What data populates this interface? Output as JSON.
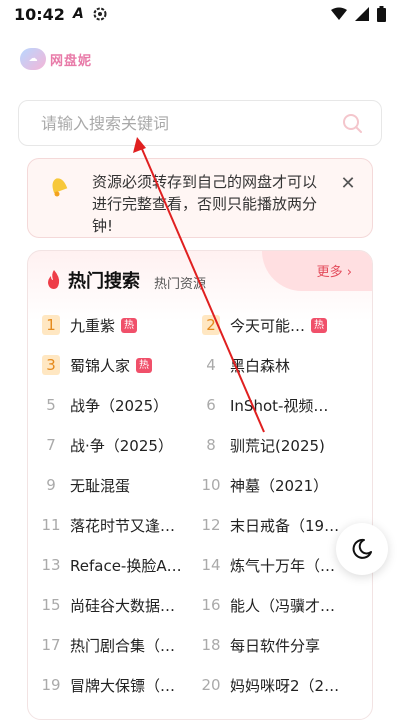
{
  "status_bar": {
    "time": "10:42"
  },
  "logo": {
    "text": "网盘妮"
  },
  "search": {
    "placeholder": "请输入搜索关键词",
    "value": ""
  },
  "notice": {
    "text": "资源必须转存到自己的网盘才可以进行完整查看，否则只能播放两分钟!"
  },
  "hot": {
    "title": "热门搜索",
    "subtitle": "热门资源",
    "more_label": "更多 ›",
    "hot_badge": "热",
    "items": [
      {
        "rank": "1",
        "title": "九重紫",
        "hot": true
      },
      {
        "rank": "2",
        "title": "今天可能…",
        "hot": true
      },
      {
        "rank": "3",
        "title": "蜀锦人家",
        "hot": true
      },
      {
        "rank": "4",
        "title": "黑白森林",
        "hot": false
      },
      {
        "rank": "5",
        "title": "战争（2025）",
        "hot": false
      },
      {
        "rank": "6",
        "title": "InShot-视频…",
        "hot": false
      },
      {
        "rank": "7",
        "title": "战·争（2025）",
        "hot": false
      },
      {
        "rank": "8",
        "title": "驯荒记(2025)",
        "hot": false
      },
      {
        "rank": "9",
        "title": "无耻混蛋",
        "hot": false
      },
      {
        "rank": "10",
        "title": "神墓（2021）",
        "hot": false
      },
      {
        "rank": "11",
        "title": "落花时节又逢…",
        "hot": false
      },
      {
        "rank": "12",
        "title": "末日戒备（19…",
        "hot": false
      },
      {
        "rank": "13",
        "title": "Reface-换脸A…",
        "hot": false
      },
      {
        "rank": "14",
        "title": "炼气十万年（…",
        "hot": false
      },
      {
        "rank": "15",
        "title": "尚硅谷大数据…",
        "hot": false
      },
      {
        "rank": "16",
        "title": "能人（冯骥才…",
        "hot": false
      },
      {
        "rank": "17",
        "title": "热门剧合集（…",
        "hot": false
      },
      {
        "rank": "18",
        "title": "每日软件分享",
        "hot": false
      },
      {
        "rank": "19",
        "title": "冒牌大保镖（…",
        "hot": false
      },
      {
        "rank": "20",
        "title": "妈妈咪呀2（2…",
        "hot": false
      }
    ]
  },
  "colors": {
    "accent": "#e34b5b",
    "badge": "#f0506a",
    "rank_top_bg": "#ffe7c2",
    "rank_top_fg": "#e58a1c",
    "annotation_arrow": "#e02020"
  },
  "icons": [
    "a-icon",
    "gear-icon",
    "wifi-icon",
    "signal-icon",
    "battery-icon",
    "search-icon",
    "bell-icon",
    "close-icon",
    "flame-icon",
    "moon-icon"
  ]
}
